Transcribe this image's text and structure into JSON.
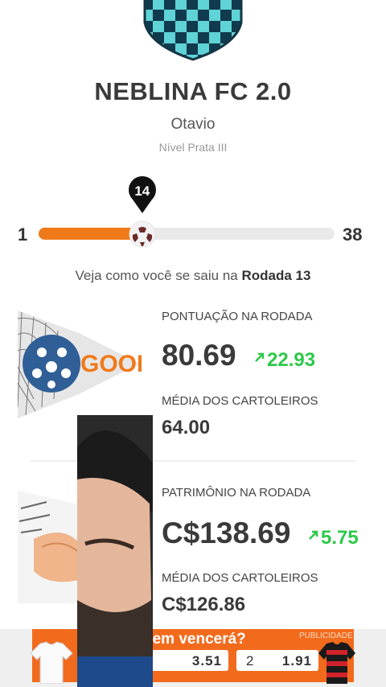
{
  "team": {
    "name": "NEBLINA FC 2.0",
    "owner": "Otavio",
    "level": "Nível Prata III"
  },
  "progress": {
    "start": "1",
    "end": "38",
    "current": "14",
    "fraction": 0.35
  },
  "round_info": {
    "prefix": "Veja como você se saiu na ",
    "round": "Rodada 13"
  },
  "score": {
    "label": "PONTUAÇÃO NA RODADA",
    "value": "80.69",
    "delta": "22.93",
    "avg_label": "MÉDIA DOS CARTOLEIROS",
    "avg_value": "64.00",
    "illustration_text": "GOOL"
  },
  "patrimony": {
    "label": "PATRIMÔNIO NA RODADA",
    "value": "C$138.69",
    "delta": "5.75",
    "avg_label": "MÉDIA DOS CARTOLEIROS",
    "avg_value": "C$126.86"
  },
  "ad": {
    "tag": "PUBLICIDADE",
    "question": "uem vencerá?",
    "odd1": "3.51",
    "choice2": "2",
    "odd2": "1.91"
  },
  "colors": {
    "accent": "#f07a1a",
    "positive": "#2ec84a",
    "ad_bg": "#f26b1d",
    "crest": "#5fd3d6"
  }
}
